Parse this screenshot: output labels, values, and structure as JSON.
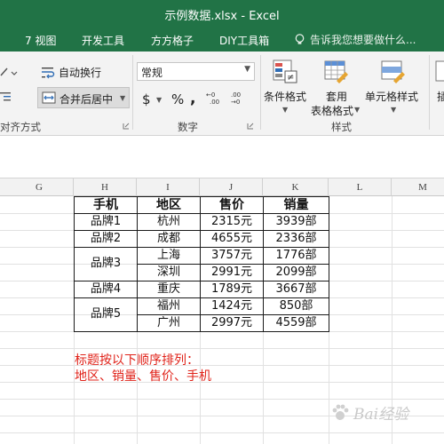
{
  "window": {
    "title": "示例数据.xlsx - Excel"
  },
  "menu": {
    "items": [
      "7 视图",
      "开发工具",
      "方方格子",
      "DIY工具箱"
    ],
    "tell_me": "告诉我您想要做什么..."
  },
  "ribbon": {
    "wrap_text": "自动换行",
    "merge_center": "合并后居中",
    "alignment_label": "对齐方式",
    "number_format": "常规",
    "currency_symbol": "$",
    "percent_symbol": "%",
    "comma_symbol": ",",
    "number_label": "数字",
    "conditional_format": "条件格式",
    "table_format_1": "套用",
    "table_format_2": "表格格式",
    "cell_style": "单元格样式",
    "styles_label": "样式",
    "insert_partial": "插"
  },
  "grid": {
    "columns": [
      "G",
      "H",
      "I",
      "J",
      "K",
      "L",
      "M"
    ],
    "table": {
      "headers": [
        "手机",
        "地区",
        "售价",
        "销量"
      ],
      "rows": [
        {
          "phone": "品牌1",
          "region": "杭州",
          "price": "2315元",
          "sales": "3939部"
        },
        {
          "phone": "品牌2",
          "region": "成都",
          "price": "4655元",
          "sales": "2336部"
        },
        {
          "phone": "品牌3",
          "region": "上海",
          "price": "3757元",
          "sales": "1776部"
        },
        {
          "phone": "",
          "region": "深圳",
          "price": "2991元",
          "sales": "2099部"
        },
        {
          "phone": "品牌4",
          "region": "重庆",
          "price": "1789元",
          "sales": "3667部"
        },
        {
          "phone": "品牌5",
          "region": "福州",
          "price": "1424元",
          "sales": "850部"
        },
        {
          "phone": "",
          "region": "广州",
          "price": "2997元",
          "sales": "4559部"
        }
      ]
    },
    "note_line1": "标题按以下顺序排列：",
    "note_line2": "地区、销量、售价、手机"
  },
  "watermark": {
    "text": "Bai经验"
  },
  "colors": {
    "excel_green": "#217346",
    "note_red": "#e0231a"
  }
}
